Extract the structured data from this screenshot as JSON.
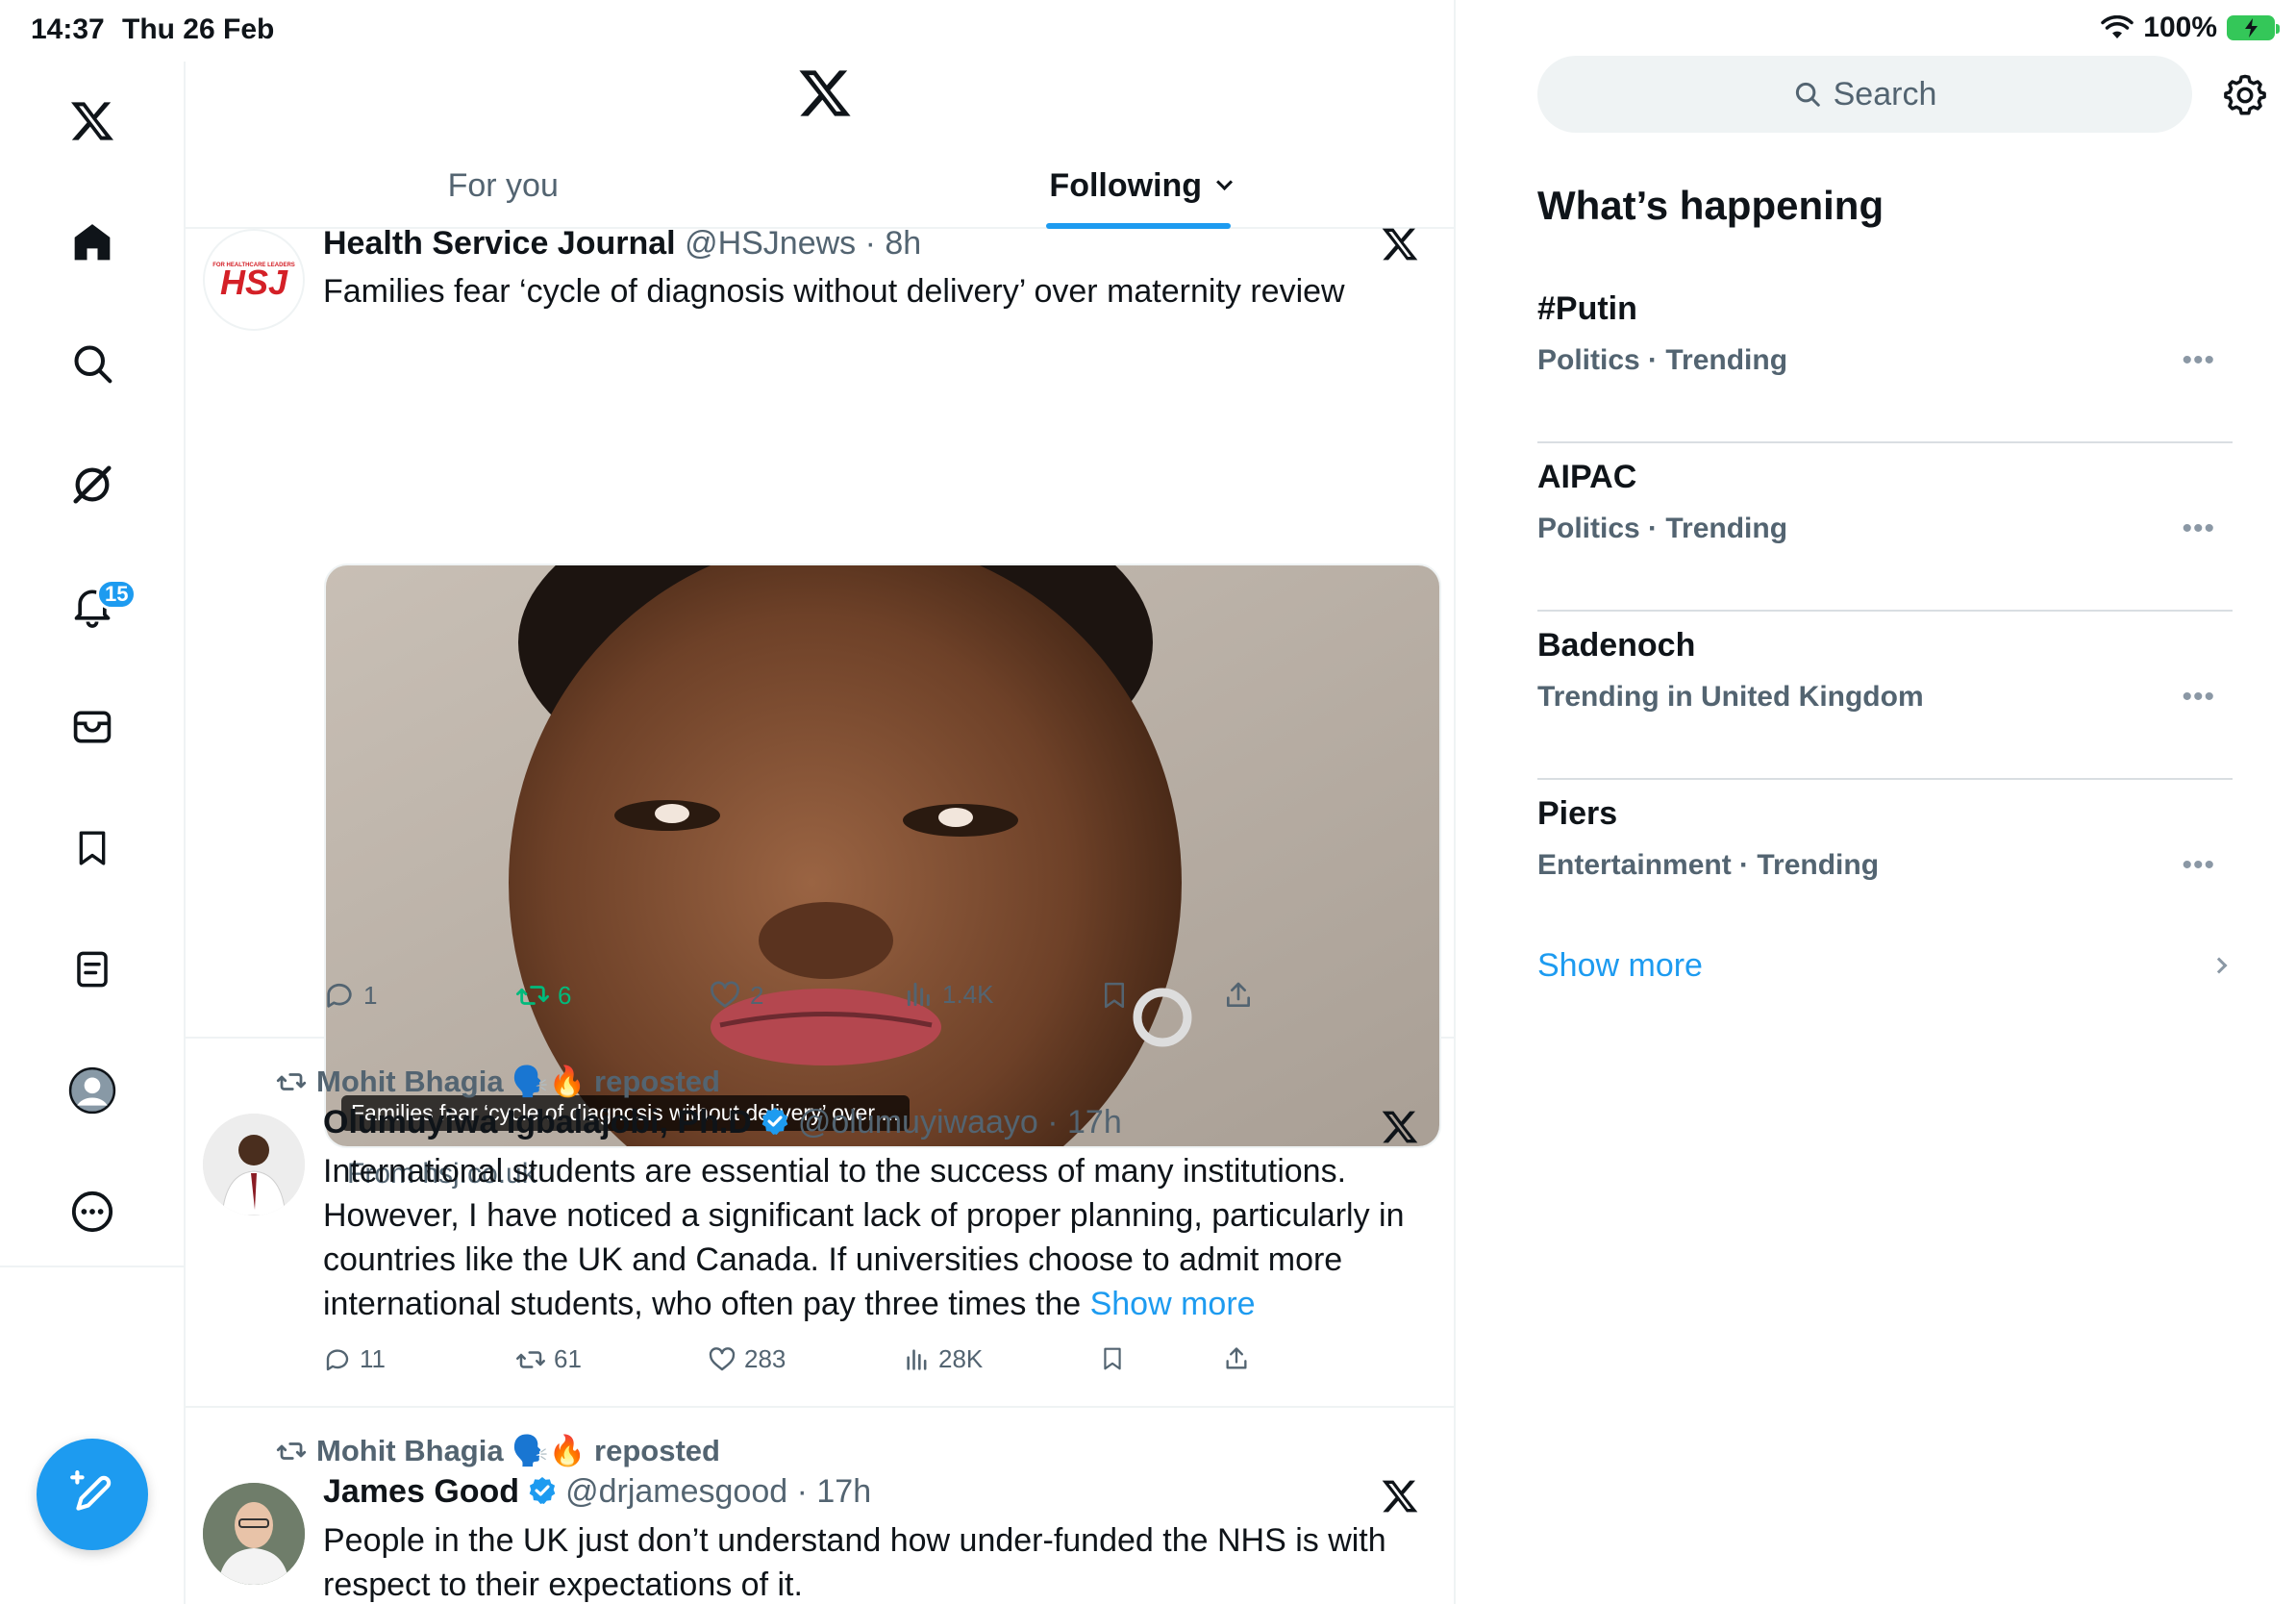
{
  "status": {
    "time": "14:37",
    "date": "Thu 26 Feb",
    "battery": "100%"
  },
  "nav": {
    "notifications_badge": "15"
  },
  "tabs": [
    {
      "label": "For you"
    },
    {
      "label": "Following"
    }
  ],
  "posts": [
    {
      "name": "Health Service Journal",
      "meta": "@HSJnews · 8h",
      "avatar_text": "HSJ",
      "avatar_tagline": "FOR HEALTHCARE LEADERS",
      "text": "Families fear ‘cycle of diagnosis without delivery’ over maternity review",
      "media_caption": "Families fear ‘cycle of diagnosis without delivery’ over ...",
      "from": "From hsj.co.uk",
      "replies": "1",
      "reposts": "6",
      "likes": "2",
      "views": "1.4K"
    },
    {
      "reposted_by": "Mohit Bhagia 🗣️🔥 reposted",
      "name": "Olumuyiwa Igbalajobi, Ph.D",
      "meta": "@olumuyiwaayo · 17h",
      "text": "International students are essential to the success of many institutions. However, I have noticed a significant lack of proper planning, particularly in countries like the UK and Canada. If universities choose to admit more international students, who often pay three times the ",
      "show_more": "Show more",
      "replies": "11",
      "reposts": "61",
      "likes": "283",
      "views": "28K"
    },
    {
      "reposted_by": "Mohit Bhagia 🗣️🔥 reposted",
      "name": "James Good",
      "meta": "@drjamesgood · 17h",
      "text": "People in the UK just don’t understand how under-funded the NHS is with respect to their expectations of it."
    }
  ],
  "sidebar": {
    "search_placeholder": "Search",
    "whats_happening": "What’s happening",
    "trends": [
      {
        "name": "#Putin",
        "category": "Politics · Trending"
      },
      {
        "name": "AIPAC",
        "category": "Politics · Trending"
      },
      {
        "name": "Badenoch",
        "category": "Trending in United Kingdom"
      },
      {
        "name": "Piers",
        "category": "Entertainment · Trending"
      }
    ],
    "show_more": "Show more"
  },
  "colors": {
    "accent": "#1d9bf0",
    "repost_green": "#00ba7c",
    "secondary_text": "#536471",
    "hsj_red": "#d42027"
  }
}
